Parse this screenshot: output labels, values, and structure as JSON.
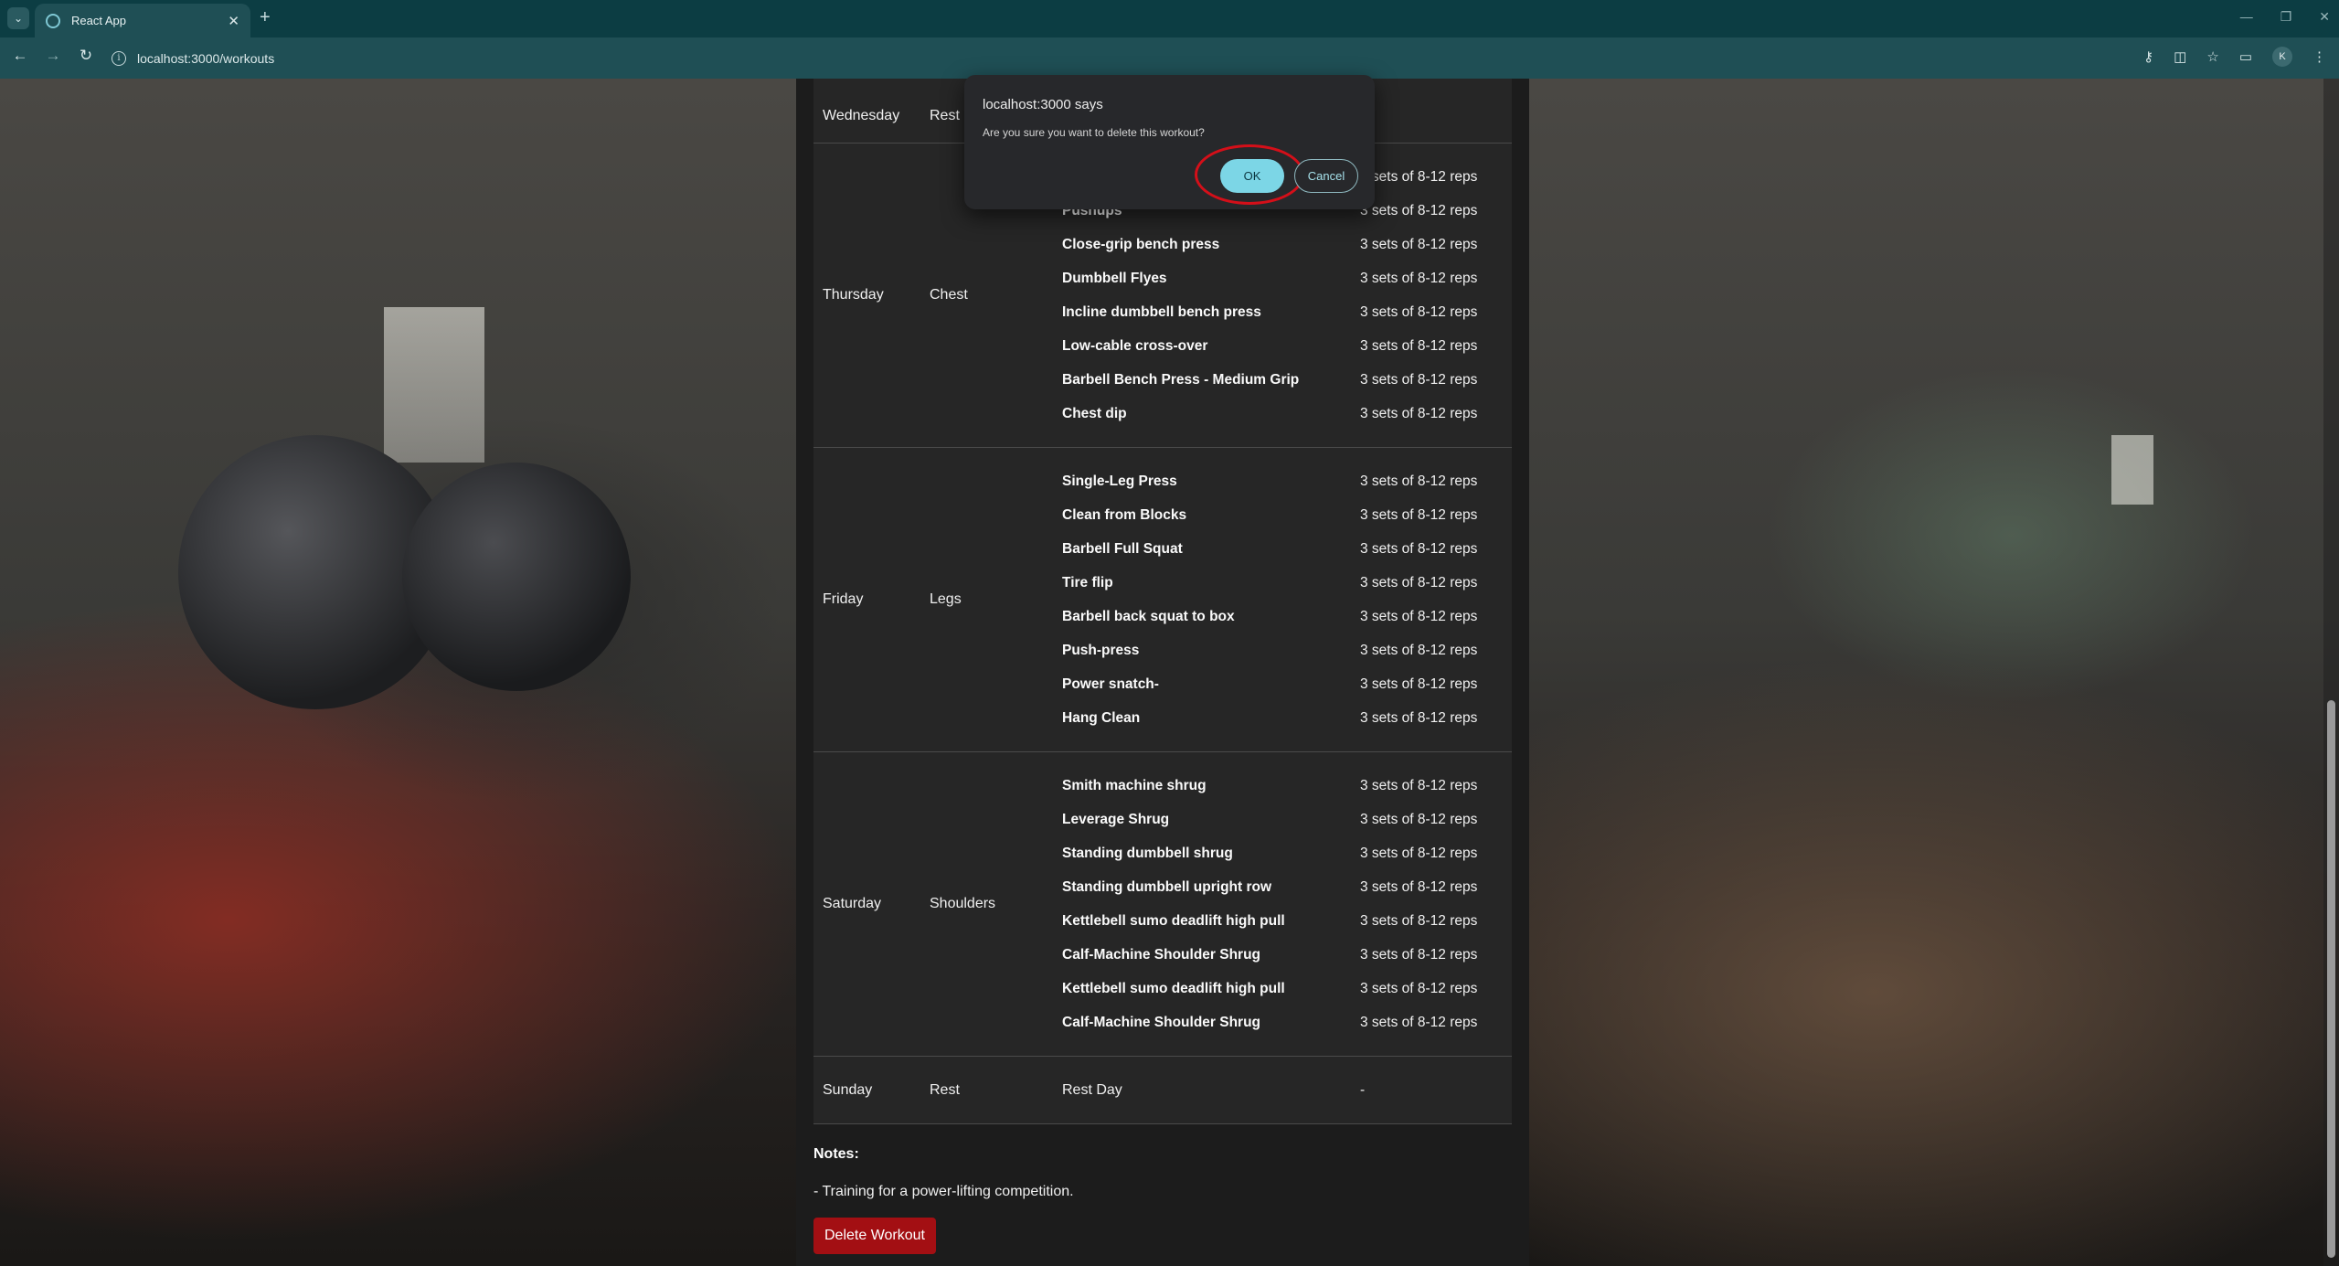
{
  "browser": {
    "tab_title": "React App",
    "url": "localhost:3000/workouts",
    "profile_initial": "K"
  },
  "schedule": {
    "wednesday": {
      "day": "Wednesday",
      "focus": "Rest"
    },
    "thursday": {
      "day": "Thursday",
      "focus": "Chest",
      "exercises": [
        {
          "name": "",
          "sets": "3 sets of 8-12 reps"
        },
        {
          "name": "Pushups",
          "sets": "3 sets of 8-12 reps"
        },
        {
          "name": "Close-grip bench press",
          "sets": "3 sets of 8-12 reps"
        },
        {
          "name": "Dumbbell Flyes",
          "sets": "3 sets of 8-12 reps"
        },
        {
          "name": "Incline dumbbell bench press",
          "sets": "3 sets of 8-12 reps"
        },
        {
          "name": "Low-cable cross-over",
          "sets": "3 sets of 8-12 reps"
        },
        {
          "name": "Barbell Bench Press - Medium Grip",
          "sets": "3 sets of 8-12 reps"
        },
        {
          "name": "Chest dip",
          "sets": "3 sets of 8-12 reps"
        }
      ]
    },
    "friday": {
      "day": "Friday",
      "focus": "Legs",
      "exercises": [
        {
          "name": "Single-Leg Press",
          "sets": "3 sets of 8-12 reps"
        },
        {
          "name": "Clean from Blocks",
          "sets": "3 sets of 8-12 reps"
        },
        {
          "name": "Barbell Full Squat",
          "sets": "3 sets of 8-12 reps"
        },
        {
          "name": "Tire flip",
          "sets": "3 sets of 8-12 reps"
        },
        {
          "name": "Barbell back squat to box",
          "sets": "3 sets of 8-12 reps"
        },
        {
          "name": "Push-press",
          "sets": "3 sets of 8-12 reps"
        },
        {
          "name": "Power snatch-",
          "sets": "3 sets of 8-12 reps"
        },
        {
          "name": "Hang Clean",
          "sets": "3 sets of 8-12 reps"
        }
      ]
    },
    "saturday": {
      "day": "Saturday",
      "focus": "Shoulders",
      "exercises": [
        {
          "name": "Smith machine shrug",
          "sets": "3 sets of 8-12 reps"
        },
        {
          "name": "Leverage Shrug",
          "sets": "3 sets of 8-12 reps"
        },
        {
          "name": "Standing dumbbell shrug",
          "sets": "3 sets of 8-12 reps"
        },
        {
          "name": "Standing dumbbell upright row",
          "sets": "3 sets of 8-12 reps"
        },
        {
          "name": "Kettlebell sumo deadlift high pull",
          "sets": "3 sets of 8-12 reps"
        },
        {
          "name": "Calf-Machine Shoulder Shrug",
          "sets": "3 sets of 8-12 reps"
        },
        {
          "name": "Kettlebell sumo deadlift high pull",
          "sets": "3 sets of 8-12 reps"
        },
        {
          "name": "Calf-Machine Shoulder Shrug",
          "sets": "3 sets of 8-12 reps"
        }
      ]
    },
    "sunday": {
      "day": "Sunday",
      "focus": "Rest",
      "exercise": "Rest Day",
      "sets": "-"
    }
  },
  "notes": {
    "label": "Notes:",
    "text": "- Training for a power-lifting competition."
  },
  "delete_button_label": "Delete Workout",
  "dialog": {
    "title": "localhost:3000 says",
    "message": "Are you sure you want to delete this workout?",
    "ok_label": "OK",
    "cancel_label": "Cancel"
  }
}
